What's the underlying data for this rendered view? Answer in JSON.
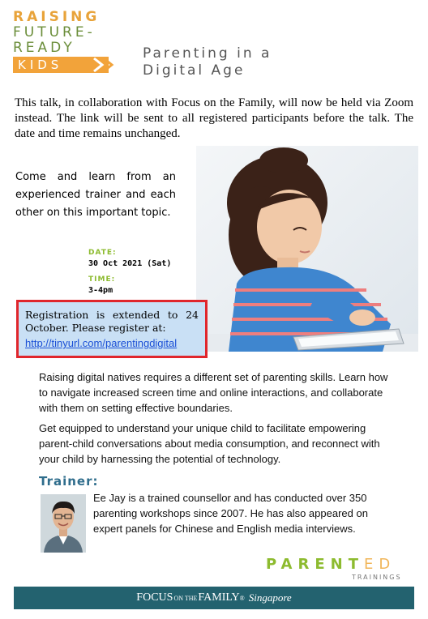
{
  "logo": {
    "line1": "RAISING",
    "line2": "FUTURE-",
    "line3": "READY",
    "line4": "KIDS"
  },
  "title": {
    "line1": "Parenting in a",
    "line2": "Digital Age"
  },
  "intro": "This talk, in collaboration with Focus on the Family, will now be held via Zoom instead. The link will be sent to all registered participants before the talk.  The date and time remains unchanged.",
  "come_learn": "Come and learn from an experienced trainer and each other on this important topic.",
  "event": {
    "date_label": "DATE:",
    "date_value": "30 Oct 2021 (Sat)",
    "time_label": "TIME:",
    "time_value": "3-4pm"
  },
  "registration": {
    "text": "Registration is extended to 24 October. Please register at:",
    "link": "http://tinyurl.com/parentingdigital"
  },
  "body": {
    "para1": "Raising digital natives requires a different set of parenting skills. Learn how to navigate increased screen time and online interactions, and collaborate with them on setting effective boundaries.",
    "para2": "Get equipped to understand your unique child to facilitate empowering parent-child conversations about media consumption, and reconnect with your child by harnessing the potential of technology."
  },
  "trainer": {
    "heading": "Trainer:",
    "bio": "Ee Jay is a trained counsellor and has conducted over 350 parenting workshops since 2007. He has also appeared on expert panels for Chinese and English media interviews."
  },
  "parented": {
    "main": "PARENT",
    "suffix": "ED",
    "sub": "TRAININGS"
  },
  "footer": {
    "focus": "FOCUS",
    "on_the": "ON THE",
    "family": "FAMILY",
    "reg": "®",
    "country": "Singapore"
  },
  "colors": {
    "logo_orange": "#f2a33a",
    "logo_green": "#6b8e3a",
    "label_green": "#8dbb2f",
    "highlight_border": "#e0262c",
    "highlight_fill": "#c9e0f5",
    "trainer_heading": "#2f6d8c",
    "footer_bg": "#23626f"
  },
  "icons": [
    "chevron-arrows-icon"
  ],
  "images": [
    "child-with-tablet-photo",
    "trainer-portrait-photo"
  ]
}
